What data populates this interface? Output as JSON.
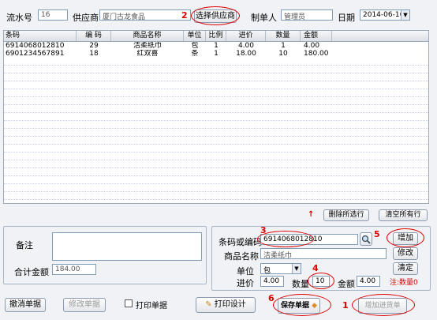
{
  "header": {
    "serial_label": "流水号",
    "serial_value": "16",
    "supplier_label": "供应商",
    "supplier_value": "厦门古龙食品",
    "select_supplier_btn": "选择供应商",
    "maker_label": "制单人",
    "maker_value": "管理员",
    "date_label": "日期",
    "date_value": "2014-06-16"
  },
  "grid": {
    "columns": [
      "条码",
      "编 码",
      "商品名称",
      "单位",
      "比例",
      "进价",
      "数量",
      "金额"
    ],
    "rows": [
      [
        "6914068012810",
        "29",
        "洁柔纸巾",
        "包",
        "1",
        "4.00",
        "1",
        "4.00"
      ],
      [
        "6901234567891",
        "18",
        "红双喜",
        "条",
        "1",
        "18.00",
        "10",
        "180.00"
      ]
    ]
  },
  "grid_actions": {
    "delete_selected": "删除所选行",
    "clear_all": "清空所有行"
  },
  "left_panel": {
    "remark_label": "备注",
    "total_label": "合计金额",
    "total_value": "184.00"
  },
  "right_panel": {
    "barcode_label": "条码或编码",
    "barcode_value": "6914068012810",
    "add_btn": "增加",
    "name_label": "商品名称",
    "name_value": "洁柔纸巾",
    "modify_btn": "修改",
    "unit_label": "单位",
    "unit_value": "包",
    "clear_btn": "清定",
    "price_label": "进价",
    "price_value": "4.00",
    "qty_label": "数量",
    "qty_value": "10",
    "amount_label": "金额",
    "amount_value": "4.00",
    "note": "注:数量0"
  },
  "footer": {
    "cancel_btn": "撤消单据",
    "modify_btn": "修改单据",
    "print_check": "打印单据",
    "print_design_btn": "打印设计",
    "save_btn": "保存单据",
    "add_purchase_btn": "增加进货单"
  },
  "annotations": {
    "n1": "1",
    "n2": "2",
    "n3": "3",
    "n4": "4",
    "n5": "5",
    "n6": "6",
    "arrow": "↑"
  },
  "colors": {
    "annotation": "#dd0000",
    "grid_border": "#9aa9bd",
    "field_border": "#7f9db9",
    "background": "#f0f2f5"
  }
}
